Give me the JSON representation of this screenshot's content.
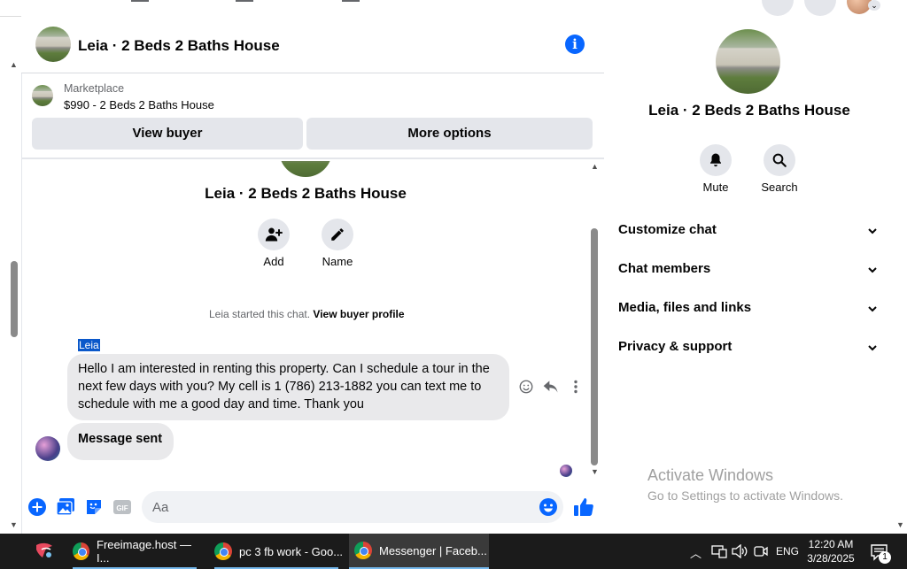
{
  "header": {
    "title": "Leia · 2 Beds 2 Baths House",
    "marketplace_label": "Marketplace",
    "listing": "$990 - 2 Beds 2 Baths House",
    "view_buyer": "View buyer",
    "more_options": "More options"
  },
  "conversation": {
    "title": "Leia · 2 Beds 2 Baths House",
    "actions": [
      {
        "label": "Add",
        "icon": "add-person-icon"
      },
      {
        "label": "Name",
        "icon": "pencil-icon"
      }
    ],
    "system_text": "Leia started this chat.",
    "system_link": "View buyer profile",
    "sender": "Leia",
    "message": "Hello I am interested in renting this property. Can I schedule a tour in the next few days with you? My cell is 1 (786) 213-1882 you can text me to schedule with me a good day and time. Thank you",
    "sent_message": "Message sent"
  },
  "composer": {
    "placeholder": "Aa"
  },
  "right_panel": {
    "title": "Leia · 2 Beds 2 Baths House",
    "mute_label": "Mute",
    "search_label": "Search",
    "rows": [
      "Customize chat",
      "Chat members",
      "Media, files and links",
      "Privacy & support"
    ]
  },
  "watermark": {
    "line1": "Activate Windows",
    "line2": "Go to Settings to activate Windows."
  },
  "taskbar": {
    "items": [
      "Freeimage.host — I...",
      "pc 3 fb work - Goo...",
      "Messenger | Faceb..."
    ],
    "language": "ENG",
    "time": "12:20 AM",
    "date": "3/28/2025",
    "notification_count": "1"
  },
  "colors": {
    "accent": "#0866ff",
    "bubble": "#e9e9eb",
    "button_gray": "#e4e6eb",
    "taskbar": "#1b1b1b"
  }
}
